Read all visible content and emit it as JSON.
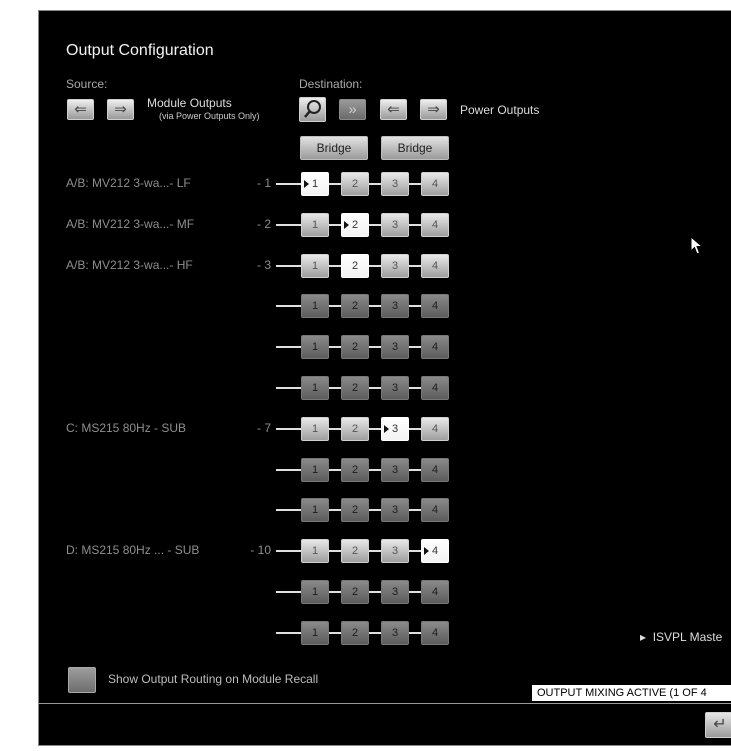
{
  "title": "Output Configuration",
  "source": {
    "label": "Source:"
  },
  "destination": {
    "label": "Destination:"
  },
  "module_outputs": {
    "label": "Module Outputs",
    "sublabel": "(via Power Outputs Only)"
  },
  "power_outputs": {
    "label": "Power Outputs"
  },
  "bridge_label": "Bridge",
  "rows": [
    {
      "label": "A/B: MV212 3-wa...- LF",
      "num": "- 1",
      "active": 1
    },
    {
      "label": "A/B: MV212 3-wa...- MF",
      "num": "- 2",
      "active": 2
    },
    {
      "label": "A/B: MV212 3-wa...- HF",
      "num": "- 3",
      "active": 2
    },
    {
      "label": "",
      "num": "",
      "active": 0
    },
    {
      "label": "",
      "num": "",
      "active": 0
    },
    {
      "label": "",
      "num": "",
      "active": 0
    },
    {
      "label": "C: MS215 80Hz     -  SUB",
      "num": "- 7",
      "active": 3
    },
    {
      "label": "",
      "num": "",
      "active": 0
    },
    {
      "label": "",
      "num": "",
      "active": 0
    },
    {
      "label": "D: MS215 80Hz ... -  SUB",
      "num": "- 10",
      "active": 4
    },
    {
      "label": "",
      "num": "",
      "active": 0
    },
    {
      "label": "",
      "num": "",
      "active": 0
    }
  ],
  "marked_cells": [
    [
      0,
      1
    ],
    [
      1,
      2
    ],
    [
      6,
      3
    ],
    [
      9,
      4
    ]
  ],
  "channel_numbers": [
    "1",
    "2",
    "3",
    "4"
  ],
  "checkbox": {
    "label": "Show Output Routing on Module Recall",
    "checked": false
  },
  "isvpl": {
    "label": "ISVPL Maste"
  },
  "status": {
    "text": "OUTPUT MIXING ACTIVE (1 OF 4"
  },
  "icons": {
    "source_prev": "left-arrow-icon",
    "source_next": "right-arrow-icon",
    "dest_search": "magnifier-icon",
    "dest_all": "double-arrow-icon",
    "dest_prev": "left-arrow-icon",
    "dest_next": "right-arrow-icon",
    "enter": "enter-icon"
  }
}
